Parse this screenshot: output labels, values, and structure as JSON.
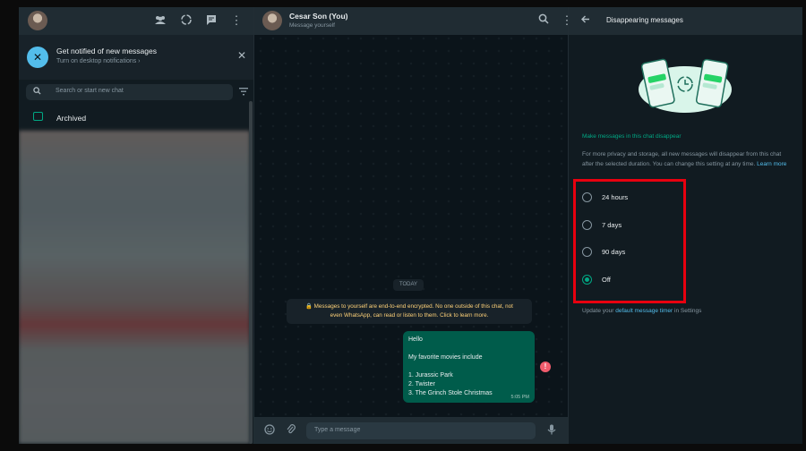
{
  "left": {
    "notify_title": "Get notified of new messages",
    "notify_sub": "Turn on desktop notifications ›",
    "search_placeholder": "Search or start new chat",
    "archived": "Archived"
  },
  "chat": {
    "name": "Cesar Son (You)",
    "subtitle": "Message yourself",
    "today": "TODAY",
    "encryption_line1": "🔒 Messages to yourself are end-to-end encrypted. No one outside of this chat, not",
    "encryption_line2": "even WhatsApp, can read or listen to them. Click to learn more.",
    "message": {
      "lines": [
        "Hello",
        "My favorite movies include",
        "1. Jurassic Park",
        "2. Twister",
        "3. The Grinch Stole Christmas"
      ],
      "time": "5:05 PM"
    },
    "composer_placeholder": "Type a message"
  },
  "right": {
    "title": "Disappearing messages",
    "heading": "Make messages in this chat disappear",
    "description": "For more privacy and storage, all new messages will disappear from this chat after the selected duration. You can change this setting at any time.",
    "learn_more": "Learn more",
    "options": [
      "24 hours",
      "7 days",
      "90 days",
      "Off"
    ],
    "selected": "Off",
    "update_prefix": "Update your",
    "update_link": "default message timer",
    "update_suffix": "in Settings"
  },
  "colors": {
    "accent": "#00a884",
    "link": "#53bdeb",
    "highlight_box": "#e8000f",
    "bubble": "#005c4b"
  },
  "icons": [
    "community-icon",
    "status-icon",
    "new-chat-icon",
    "menu-icon",
    "search-icon",
    "close-icon",
    "filter-icon",
    "archive-icon",
    "back-arrow-icon",
    "emoji-icon",
    "attach-icon",
    "mic-icon",
    "error-icon"
  ]
}
